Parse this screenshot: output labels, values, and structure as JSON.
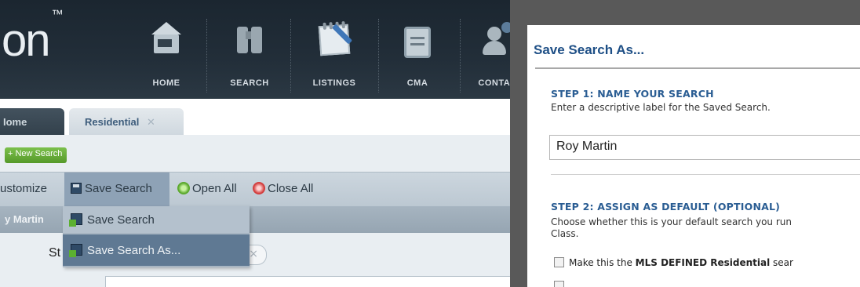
{
  "header": {
    "logo_text": "on",
    "logo_mark": "™",
    "nav": [
      {
        "label": "HOME",
        "icon": "home-icon"
      },
      {
        "label": "SEARCH",
        "icon": "binoculars-icon"
      },
      {
        "label": "LISTINGS",
        "icon": "listings-notepad-icon"
      },
      {
        "label": "CMA",
        "icon": "clipboard-icon"
      },
      {
        "label": "CONTAC",
        "icon": "contacts-icon"
      }
    ]
  },
  "tabs": [
    {
      "label": "Iome"
    },
    {
      "label": "Residential",
      "close": "✕"
    }
  ],
  "workspace": {
    "new_search": "+ New Search",
    "toolbar": {
      "customize": "ustomize",
      "save_search": "Save Search",
      "open_all": "Open All",
      "close_all": "Close All"
    },
    "search_label": "y Martin",
    "field_label": "St",
    "chip_close": "×"
  },
  "dropdown": {
    "items": [
      {
        "label": "Save Search"
      },
      {
        "label": "Save Search As..."
      }
    ]
  },
  "modal": {
    "title": "Save Search As...",
    "step1": {
      "heading": "STEP 1:  NAME YOUR SEARCH",
      "description": "Enter a descriptive label for the Saved Search.",
      "input_value": "Roy Martin"
    },
    "step2": {
      "heading": "STEP 2:  ASSIGN AS DEFAULT (OPTIONAL)",
      "description_line1": "Choose whether this is your default search you run",
      "description_line2": "Class.",
      "checkbox1_prefix": "Make this the ",
      "checkbox1_bold": "MLS DEFINED Residential",
      "checkbox1_suffix": " sear"
    }
  }
}
